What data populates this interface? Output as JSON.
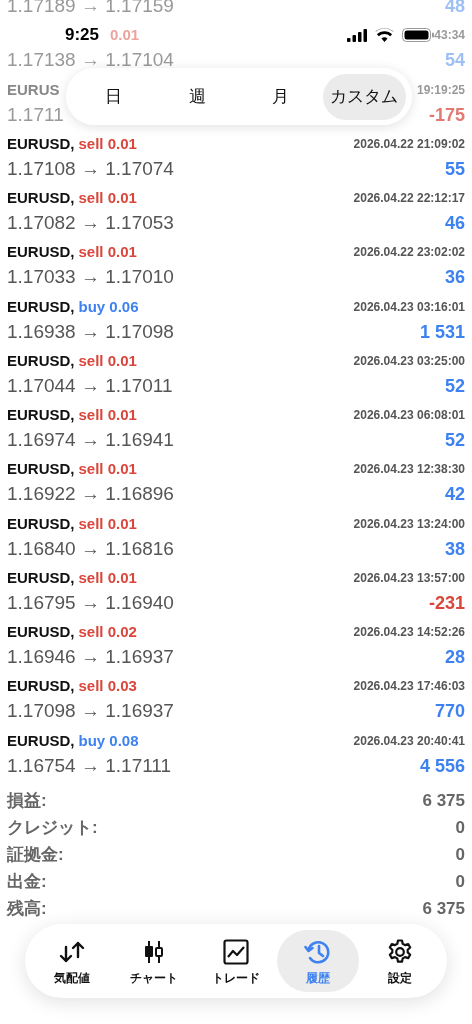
{
  "status_bar": {
    "time": "9:25"
  },
  "period_tabs": [
    {
      "label": "日",
      "selected": false
    },
    {
      "label": "週",
      "selected": false
    },
    {
      "label": "月",
      "selected": false
    },
    {
      "label": "カスタム",
      "selected": true
    }
  ],
  "partial_rows": [
    {
      "prices": "1.17189 → 1.17159",
      "profit": {
        "text": "48",
        "color": "#9ec0f5"
      }
    },
    {
      "side": {
        "text": "0.01",
        "color": "#eda39d"
      },
      "datetime": "43:34",
      "prices": "1.17138 → 1.17104",
      "profit": {
        "text": "54",
        "color": "#9ec0f5"
      }
    },
    {
      "symbol": "EURUS",
      "datetime": "19:19:25",
      "prices": "1.1711",
      "profit": {
        "text": "-175",
        "color": "#e07a72"
      }
    }
  ],
  "trades": [
    {
      "symbol": "EURUSD,",
      "side": {
        "text": "sell 0.01",
        "color": "#d9463b"
      },
      "datetime": "2026.04.22 21:09:02",
      "prices": "1.17108 → 1.17074",
      "profit": {
        "text": "55",
        "color": "#3d82f0"
      }
    },
    {
      "symbol": "EURUSD,",
      "side": {
        "text": "sell 0.01",
        "color": "#d9463b"
      },
      "datetime": "2026.04.22 22:12:17",
      "prices": "1.17082 → 1.17053",
      "profit": {
        "text": "46",
        "color": "#3d82f0"
      }
    },
    {
      "symbol": "EURUSD,",
      "side": {
        "text": "sell 0.01",
        "color": "#d9463b"
      },
      "datetime": "2026.04.22 23:02:02",
      "prices": "1.17033 → 1.17010",
      "profit": {
        "text": "36",
        "color": "#3d82f0"
      }
    },
    {
      "symbol": "EURUSD,",
      "side": {
        "text": "buy 0.06",
        "color": "#3d82f0"
      },
      "datetime": "2026.04.23 03:16:01",
      "prices": "1.16938 → 1.17098",
      "profit": {
        "text": "1 531",
        "color": "#3d82f0"
      }
    },
    {
      "symbol": "EURUSD,",
      "side": {
        "text": "sell 0.01",
        "color": "#d9463b"
      },
      "datetime": "2026.04.23 03:25:00",
      "prices": "1.17044 → 1.17011",
      "profit": {
        "text": "52",
        "color": "#3d82f0"
      }
    },
    {
      "symbol": "EURUSD,",
      "side": {
        "text": "sell 0.01",
        "color": "#d9463b"
      },
      "datetime": "2026.04.23 06:08:01",
      "prices": "1.16974 → 1.16941",
      "profit": {
        "text": "52",
        "color": "#3d82f0"
      }
    },
    {
      "symbol": "EURUSD,",
      "side": {
        "text": "sell 0.01",
        "color": "#d9463b"
      },
      "datetime": "2026.04.23 12:38:30",
      "prices": "1.16922 → 1.16896",
      "profit": {
        "text": "42",
        "color": "#3d82f0"
      }
    },
    {
      "symbol": "EURUSD,",
      "side": {
        "text": "sell 0.01",
        "color": "#d9463b"
      },
      "datetime": "2026.04.23 13:24:00",
      "prices": "1.16840 → 1.16816",
      "profit": {
        "text": "38",
        "color": "#3d82f0"
      }
    },
    {
      "symbol": "EURUSD,",
      "side": {
        "text": "sell 0.01",
        "color": "#d9463b"
      },
      "datetime": "2026.04.23 13:57:00",
      "prices": "1.16795 → 1.16940",
      "profit": {
        "text": "-231",
        "color": "#d9463b"
      }
    },
    {
      "symbol": "EURUSD,",
      "side": {
        "text": "sell 0.02",
        "color": "#d9463b"
      },
      "datetime": "2026.04.23 14:52:26",
      "prices": "1.16946 → 1.16937",
      "profit": {
        "text": "28",
        "color": "#3d82f0"
      }
    },
    {
      "symbol": "EURUSD,",
      "side": {
        "text": "sell 0.03",
        "color": "#d9463b"
      },
      "datetime": "2026.04.23 17:46:03",
      "prices": "1.17098 → 1.16937",
      "profit": {
        "text": "770",
        "color": "#3d82f0"
      }
    },
    {
      "symbol": "EURUSD,",
      "side": {
        "text": "buy 0.08",
        "color": "#3d82f0"
      },
      "datetime": "2026.04.23 20:40:41",
      "prices": "1.16754 → 1.17111",
      "profit": {
        "text": "4 556",
        "color": "#3d82f0"
      }
    }
  ],
  "summary": [
    {
      "label": "損益:",
      "value": "6 375"
    },
    {
      "label": "クレジット:",
      "value": "0"
    },
    {
      "label": "証拠金:",
      "value": "0"
    },
    {
      "label": "出金:",
      "value": "0"
    },
    {
      "label": "残高:",
      "value": "6 375"
    }
  ],
  "nav": [
    {
      "kind": "quotes",
      "label": "気配値",
      "selected": false
    },
    {
      "kind": "chart",
      "label": "チャート",
      "selected": false
    },
    {
      "kind": "trade",
      "label": "トレード",
      "selected": false
    },
    {
      "kind": "history",
      "label": "履歴",
      "selected": true
    },
    {
      "kind": "settings",
      "label": "設定",
      "selected": false
    }
  ]
}
